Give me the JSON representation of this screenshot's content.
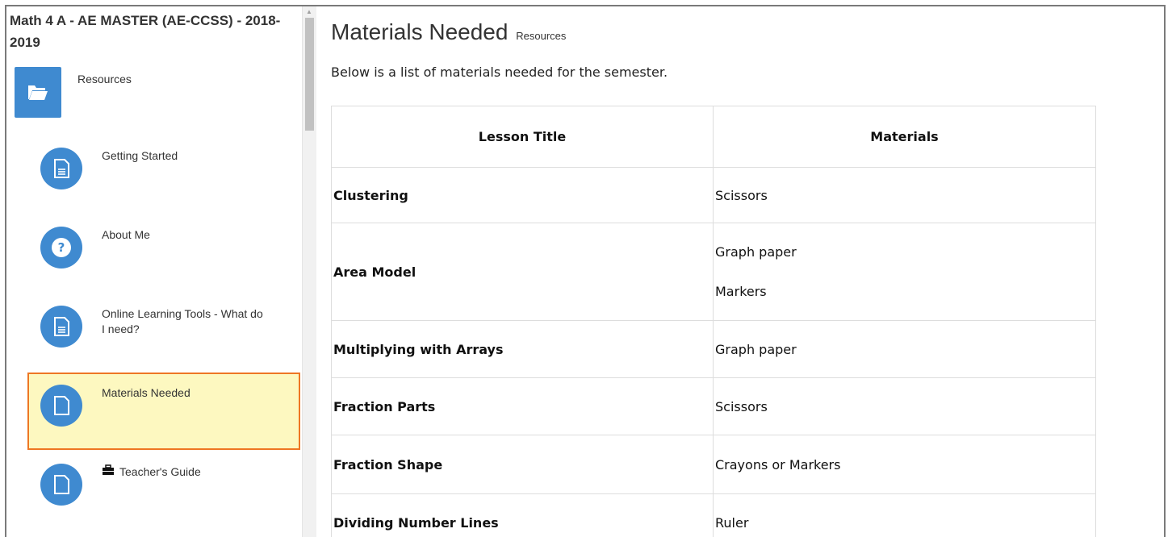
{
  "course_title": "Math 4 A - AE MASTER (AE-CCSS) - 2018-2019",
  "resources_label": "Resources",
  "nav_items": [
    {
      "label": "Getting Started",
      "icon": "document-icon"
    },
    {
      "label": "About Me",
      "icon": "question-icon"
    },
    {
      "label": "Online Learning Tools - What do I need?",
      "icon": "document-icon"
    },
    {
      "label": "Materials Needed",
      "icon": "page-icon",
      "active": true
    },
    {
      "label": "Teacher's Guide",
      "icon": "page-icon",
      "badge_icon": "briefcase-icon"
    }
  ],
  "page": {
    "title": "Materials Needed",
    "subtitle": "Resources",
    "intro": "Below is a list of materials needed for the semester."
  },
  "table": {
    "headers": [
      "Lesson Title",
      "Materials"
    ],
    "rows": [
      {
        "lesson": "Clustering",
        "materials": [
          "Scissors"
        ]
      },
      {
        "lesson": "Area Model",
        "materials": [
          "Graph paper",
          "Markers"
        ]
      },
      {
        "lesson": "Multiplying with Arrays",
        "materials": [
          "Graph paper"
        ]
      },
      {
        "lesson": "Fraction Parts",
        "materials": [
          "Scissors"
        ]
      },
      {
        "lesson": "Fraction Shape",
        "materials": [
          "Crayons or Markers"
        ]
      },
      {
        "lesson": "Dividing Number Lines",
        "materials": [
          "Ruler"
        ]
      }
    ]
  },
  "colors": {
    "accent_blue": "#3f8ad0",
    "active_bg": "#fdf8c0",
    "active_border": "#ee7623"
  }
}
